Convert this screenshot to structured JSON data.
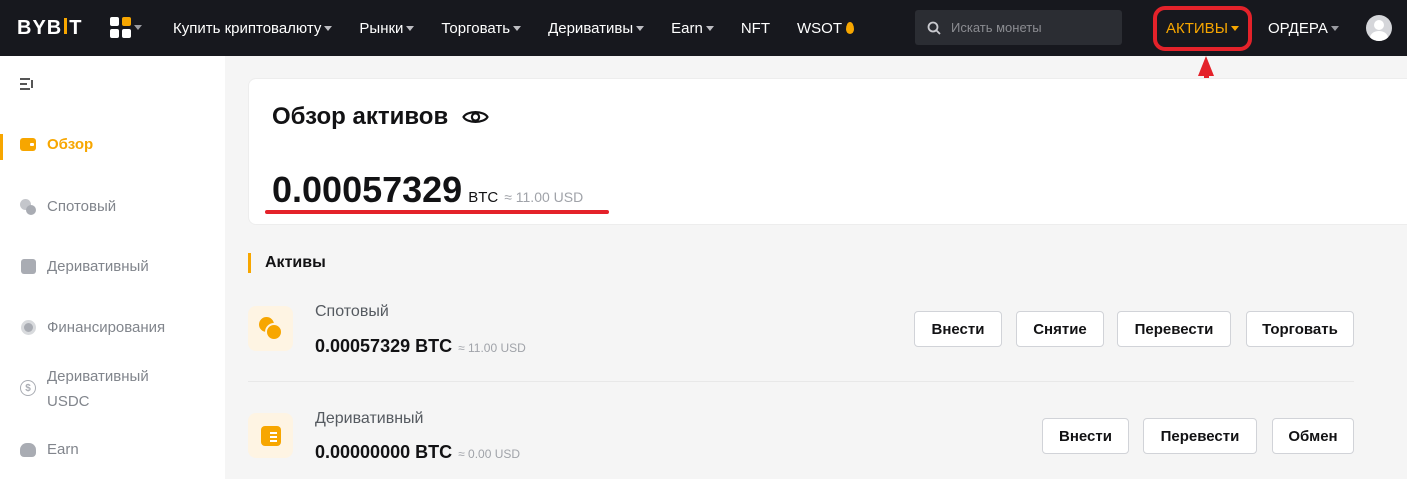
{
  "nav": {
    "logo": "BYB",
    "logo_tail": "T",
    "items": [
      {
        "label": "Купить криптовалюту",
        "caret": true
      },
      {
        "label": "Рынки",
        "caret": true
      },
      {
        "label": "Торговать",
        "caret": true
      },
      {
        "label": "Деривативы",
        "caret": true
      },
      {
        "label": "Earn",
        "caret": true
      },
      {
        "label": "NFT",
        "caret": false
      },
      {
        "label": "WSOT",
        "caret": false
      }
    ],
    "search_placeholder": "Искать монеты",
    "assets_label": "АКТИВЫ",
    "orders_label": "ОРДЕРА",
    "accent_color": "#f7a600",
    "highlight_color": "#e4222a"
  },
  "sidebar": {
    "items": [
      {
        "label": "Обзор",
        "icon": "wallet-icon",
        "active": true
      },
      {
        "label": "Спотовый",
        "icon": "coins-icon",
        "active": false
      },
      {
        "label": "Деривативный",
        "icon": "derivatives-icon",
        "active": false
      },
      {
        "label": "Финансирования",
        "icon": "finance-icon",
        "active": false
      },
      {
        "label": "Деривативный USDC",
        "icon": "usdc-icon",
        "active": false
      },
      {
        "label": "Earn",
        "icon": "earn-icon",
        "active": false
      }
    ]
  },
  "overview": {
    "title": "Обзор активов",
    "amount": "0.00057329",
    "currency": "BTC",
    "usd": "≈ 11.00 USD"
  },
  "assets": {
    "section_title": "Активы",
    "rows": [
      {
        "name": "Спотовый",
        "value": "0.00057329 BTC",
        "usd": "≈ 11.00 USD",
        "buttons": [
          "Внести",
          "Снятие",
          "Перевести",
          "Торговать"
        ]
      },
      {
        "name": "Деривативный",
        "value": "0.00000000 BTC",
        "usd": "≈ 0.00 USD",
        "buttons": [
          "Внести",
          "Перевести",
          "Обмен"
        ]
      }
    ]
  }
}
